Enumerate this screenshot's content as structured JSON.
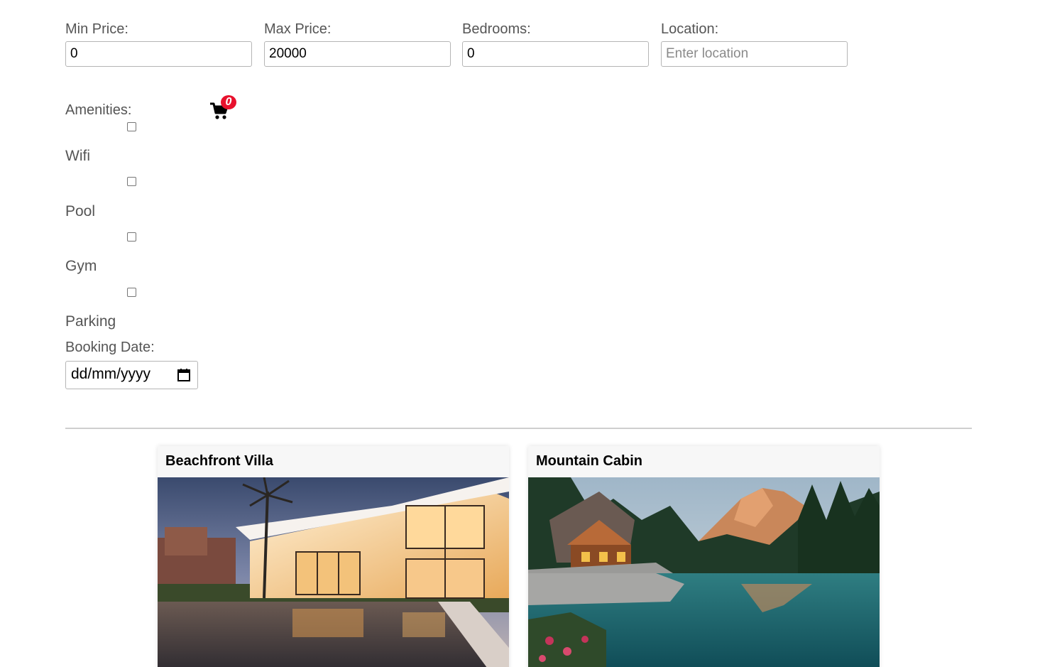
{
  "filters": {
    "min_price": {
      "label": "Min Price:",
      "value": "0"
    },
    "max_price": {
      "label": "Max Price:",
      "value": "20000"
    },
    "bedrooms": {
      "label": "Bedrooms:",
      "value": "0"
    },
    "location": {
      "label": "Location:",
      "value": "",
      "placeholder": "Enter location"
    }
  },
  "amenities": {
    "label": "Amenities:",
    "items": [
      {
        "label": "Wifi",
        "checked": false
      },
      {
        "label": "Pool",
        "checked": false
      },
      {
        "label": "Gym",
        "checked": false
      },
      {
        "label": "Parking",
        "checked": false
      }
    ]
  },
  "cart": {
    "count": "0",
    "icon": "shopping-cart-icon",
    "badge_color": "#e8112d"
  },
  "booking": {
    "label": "Booking Date:",
    "placeholder": "dd/mm/yyyy",
    "icon": "calendar-icon"
  },
  "listings": [
    {
      "title": "Beachfront Villa"
    },
    {
      "title": "Mountain Cabin"
    }
  ]
}
